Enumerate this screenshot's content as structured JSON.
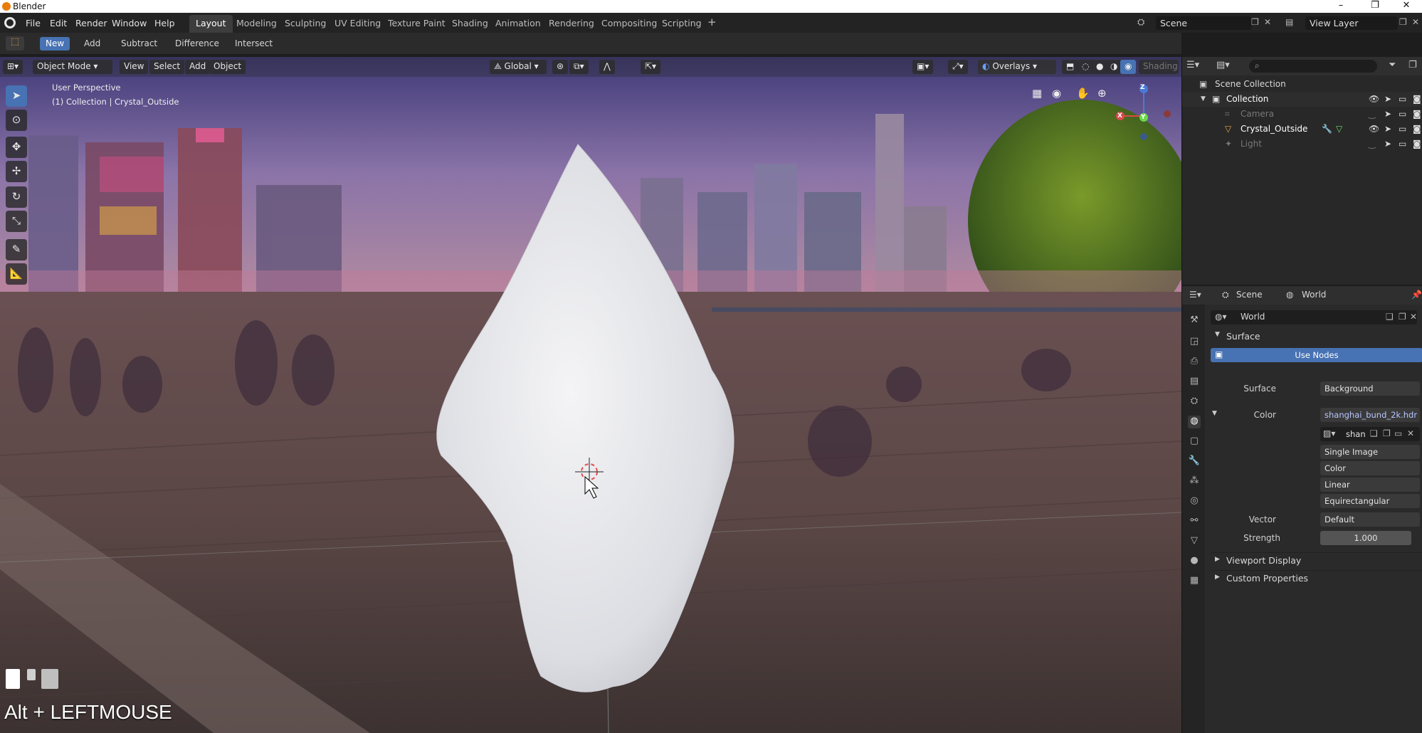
{
  "app": {
    "title": "Blender"
  },
  "window_controls": {
    "minimize": "–",
    "restore": "❐",
    "close": "✕"
  },
  "menu": {
    "items": [
      "File",
      "Edit",
      "Render",
      "Window",
      "Help"
    ]
  },
  "workspaces": {
    "tabs": [
      "Layout",
      "Modeling",
      "Sculpting",
      "UV Editing",
      "Texture Paint",
      "Shading",
      "Animation",
      "Rendering",
      "Compositing",
      "Scripting"
    ],
    "active": "Layout",
    "add_symbol": "+"
  },
  "scene_selector": {
    "scene": "Scene",
    "view_layer": "View Layer"
  },
  "toolheader": {
    "buttons": [
      "New",
      "Add",
      "Subtract",
      "Difference",
      "Intersect"
    ],
    "active": "New"
  },
  "viewport_header": {
    "mode": "Object Mode",
    "menus": [
      "View",
      "Select",
      "Add",
      "Object"
    ],
    "orientation": "Global",
    "overlays": "Overlays",
    "shading": "Shading"
  },
  "viewport": {
    "perspective": "User Perspective",
    "collection_info": "(1) Collection | Crystal_Outside",
    "gizmo_labels": {
      "x": "X",
      "y": "Y",
      "z": "Z"
    }
  },
  "shortcut_overlay": "Alt + LEFTMOUSE",
  "outliner": {
    "root": "Scene Collection",
    "collection": "Collection",
    "objects": [
      {
        "name": "Camera",
        "dimmed": true
      },
      {
        "name": "Crystal_Outside",
        "dimmed": false,
        "selected": true
      },
      {
        "name": "Light",
        "dimmed": true
      }
    ]
  },
  "properties": {
    "breadcrumb": {
      "scene": "Scene",
      "world": "World"
    },
    "world_name": "World",
    "panel_surface": "Surface",
    "use_nodes": "Use Nodes",
    "surface_label": "Surface",
    "surface_value": "Background",
    "color_label": "Color",
    "color_value": "shanghai_bund_2k.hdr",
    "image_name": "shan",
    "image_source": "Single Image",
    "color_space": "Color",
    "interpolation": "Linear",
    "projection": "Equirectangular",
    "vector_label": "Vector",
    "vector_value": "Default",
    "strength_label": "Strength",
    "strength_value": "1.000",
    "panel_viewport_display": "Viewport Display",
    "panel_custom_properties": "Custom Properties"
  },
  "colors": {
    "accent": "#4772b3",
    "selected_object": "#e8a14a"
  }
}
